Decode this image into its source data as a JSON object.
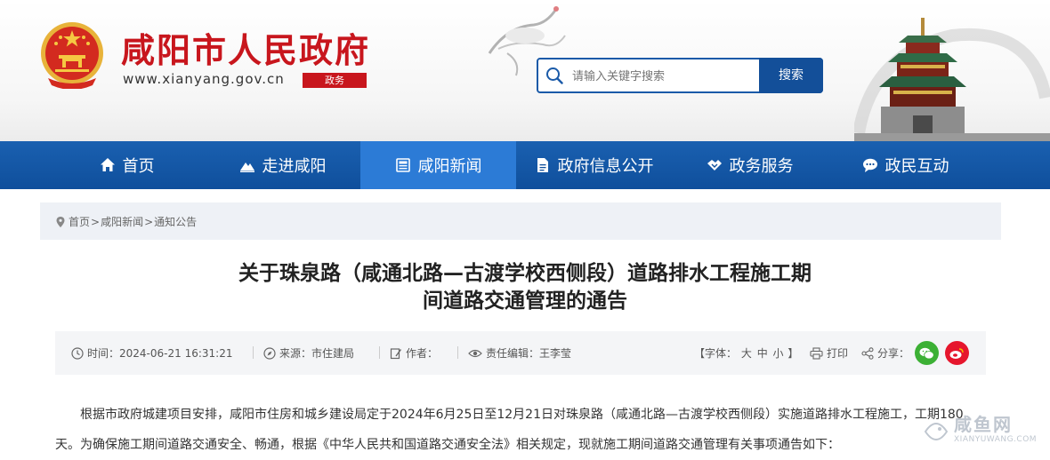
{
  "site": {
    "name": "咸阳市人民政府",
    "domain": "www.xianyang.gov.cn",
    "tag": "政务"
  },
  "search": {
    "placeholder": "请输入关键字搜索",
    "button": "搜索"
  },
  "nav": {
    "items": [
      {
        "label": "首页",
        "icon": "home-icon"
      },
      {
        "label": "走进咸阳",
        "icon": "mountain-icon"
      },
      {
        "label": "咸阳新闻",
        "icon": "news-icon"
      },
      {
        "label": "政府信息公开",
        "icon": "document-icon"
      },
      {
        "label": "政务服务",
        "icon": "handshake-icon"
      },
      {
        "label": "政民互动",
        "icon": "chat-icon"
      }
    ],
    "active": "咸阳新闻"
  },
  "breadcrumb": {
    "items": [
      "首页",
      "咸阳新闻",
      "通知公告"
    ],
    "separator": ">"
  },
  "article": {
    "title_line1": "关于珠泉路（咸通北路—古渡学校西侧段）道路排水工程施工期",
    "title_line2": "间道路交通管理的通告",
    "time_label": "时间：",
    "time_value": "2024-06-21 16:31:21",
    "source_label": "来源：",
    "source_value": "市住建局",
    "author_label": "作者：",
    "editor_label": "责任编辑：",
    "editor_value": "王李莹",
    "font_open": "【字体：",
    "font_sizes": [
      "大",
      "中",
      "小"
    ],
    "font_close": "】",
    "print_label": "打印",
    "share_label": "分享：",
    "body_line1": "根据市政府城建项目安排，咸阳市住房和城乡建设局定于2024年6月25日至12月21日对珠泉路（咸通北路—古渡学校西侧段）实施道路排水工程施工，工期180",
    "body_line2": "天。为确保施工期间道路交通安全、畅通，根据《中华人民共和国道路交通安全法》相关规定，现就施工期间道路交通管理有关事项通告如下："
  },
  "watermark": {
    "name": "咸鱼网",
    "url": "XIANYUWANG.COM"
  },
  "colors": {
    "brand_red": "#c8161d",
    "nav_blue": "#0f4f9c",
    "nav_active": "#2c7bd6",
    "wechat_green": "#3cb035",
    "weibo_red": "#e6162d"
  }
}
